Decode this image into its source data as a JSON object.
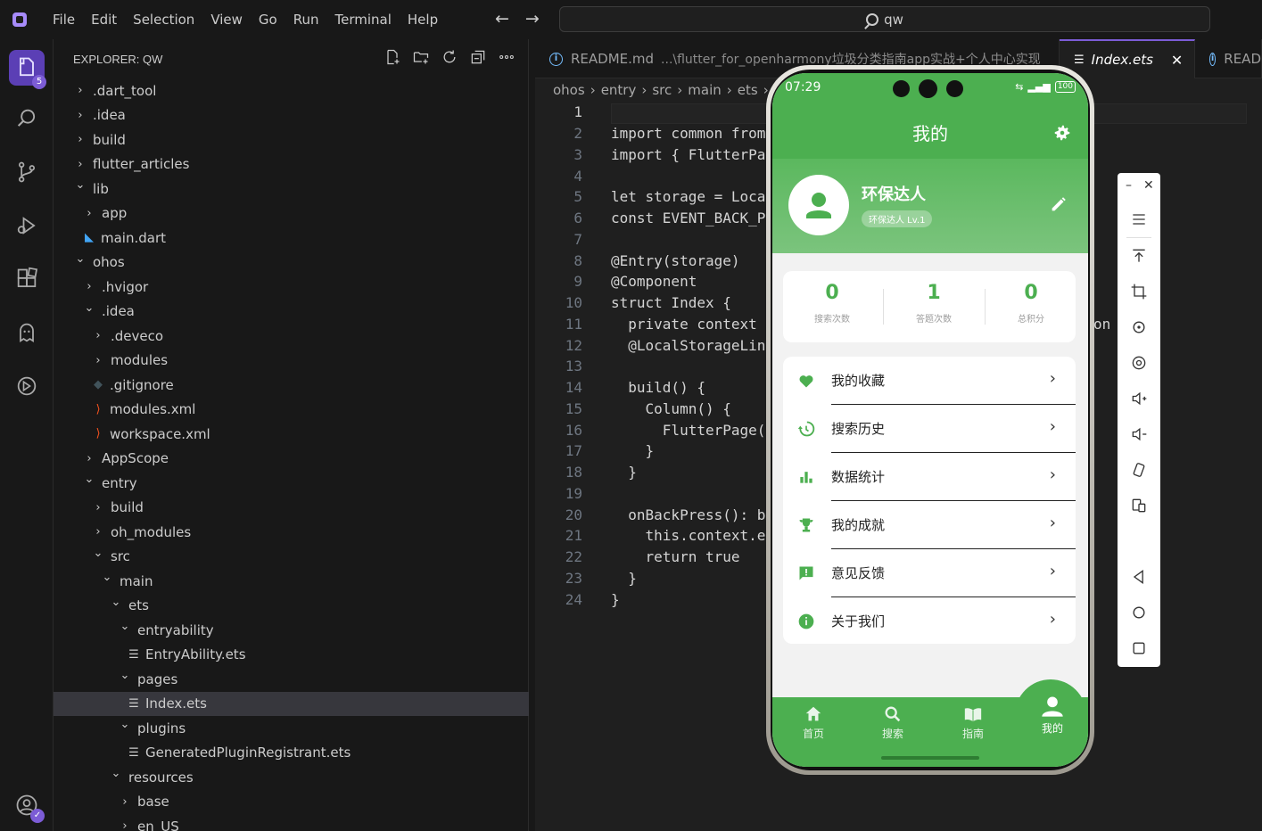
{
  "menu": [
    "File",
    "Edit",
    "Selection",
    "View",
    "Go",
    "Run",
    "Terminal",
    "Help"
  ],
  "search": {
    "text": "qw"
  },
  "activity": {
    "badge": "5"
  },
  "explorer": {
    "title": "EXPLORER: QW",
    "tree": [
      {
        "label": ".dart_tool",
        "depth": 0,
        "type": "folder",
        "open": false
      },
      {
        "label": ".idea",
        "depth": 0,
        "type": "folder",
        "open": false
      },
      {
        "label": "build",
        "depth": 0,
        "type": "folder",
        "open": false
      },
      {
        "label": "flutter_articles",
        "depth": 0,
        "type": "folder",
        "open": false
      },
      {
        "label": "lib",
        "depth": 0,
        "type": "folder",
        "open": true
      },
      {
        "label": "app",
        "depth": 1,
        "type": "folder",
        "open": false
      },
      {
        "label": "main.dart",
        "depth": 1,
        "type": "dart"
      },
      {
        "label": "ohos",
        "depth": 0,
        "type": "folder",
        "open": true
      },
      {
        "label": ".hvigor",
        "depth": 1,
        "type": "folder",
        "open": false
      },
      {
        "label": ".idea",
        "depth": 1,
        "type": "folder",
        "open": true
      },
      {
        "label": ".deveco",
        "depth": 2,
        "type": "folder",
        "open": false
      },
      {
        "label": "modules",
        "depth": 2,
        "type": "folder",
        "open": false
      },
      {
        "label": ".gitignore",
        "depth": 2,
        "type": "git"
      },
      {
        "label": "modules.xml",
        "depth": 2,
        "type": "xml"
      },
      {
        "label": "workspace.xml",
        "depth": 2,
        "type": "xml"
      },
      {
        "label": "AppScope",
        "depth": 1,
        "type": "folder",
        "open": false
      },
      {
        "label": "entry",
        "depth": 1,
        "type": "folder",
        "open": true
      },
      {
        "label": "build",
        "depth": 2,
        "type": "folder",
        "open": false
      },
      {
        "label": "oh_modules",
        "depth": 2,
        "type": "folder",
        "open": false
      },
      {
        "label": "src",
        "depth": 2,
        "type": "folder",
        "open": true
      },
      {
        "label": "main",
        "depth": 3,
        "type": "folder",
        "open": true
      },
      {
        "label": "ets",
        "depth": 4,
        "type": "folder",
        "open": true
      },
      {
        "label": "entryability",
        "depth": 5,
        "type": "folder",
        "open": true
      },
      {
        "label": "EntryAbility.ets",
        "depth": 6,
        "type": "ets"
      },
      {
        "label": "pages",
        "depth": 5,
        "type": "folder",
        "open": true
      },
      {
        "label": "Index.ets",
        "depth": 6,
        "type": "ets",
        "selected": true
      },
      {
        "label": "plugins",
        "depth": 5,
        "type": "folder",
        "open": true
      },
      {
        "label": "GeneratedPluginRegistrant.ets",
        "depth": 6,
        "type": "ets"
      },
      {
        "label": "resources",
        "depth": 4,
        "type": "folder",
        "open": true
      },
      {
        "label": "base",
        "depth": 5,
        "type": "folder",
        "open": false
      },
      {
        "label": "en_US",
        "depth": 5,
        "type": "folder",
        "open": false
      }
    ]
  },
  "tabs": [
    {
      "label": "README.md",
      "desc": "...\\flutter_for_openharmony垃圾分类指南app实战+个人中心实现",
      "active": false
    },
    {
      "label": "Index.ets",
      "active": true,
      "close": "✕"
    },
    {
      "label": "READ",
      "active": false
    }
  ],
  "breadcrumb": [
    "ohos",
    "entry",
    "src",
    "main",
    "ets"
  ],
  "code": [
    "",
    "import common from",
    "import { FlutterPa",
    "",
    "let storage = Loca",
    "const EVENT_BACK_P",
    "",
    "@Entry(storage)",
    "@Component",
    "struct Index {",
    "  private context",
    "  @LocalStorageLin",
    "",
    "  build() {",
    "    Column() {",
    "      FlutterPage(",
    "    }",
    "  }",
    "",
    "  onBackPress(): b",
    "    this.context.e",
    "    return true",
    "  }",
    "}"
  ],
  "code_overflow": "on",
  "phone": {
    "time": "07:29",
    "battery": "100",
    "title": "我的",
    "user_name": "环保达人",
    "user_level": "环保达人 Lv.1",
    "stats": [
      {
        "value": "0",
        "label": "搜索次数"
      },
      {
        "value": "1",
        "label": "答题次数"
      },
      {
        "value": "0",
        "label": "总积分"
      }
    ],
    "menu": [
      {
        "label": "我的收藏",
        "icon": "heart-icon"
      },
      {
        "label": "搜索历史",
        "icon": "history-icon"
      },
      {
        "label": "数据统计",
        "icon": "bar-chart-icon"
      },
      {
        "label": "我的成就",
        "icon": "trophy-icon"
      },
      {
        "label": "意见反馈",
        "icon": "feedback-icon"
      },
      {
        "label": "关于我们",
        "icon": "info-icon"
      }
    ],
    "tabbar": [
      {
        "label": "首页",
        "icon": "home-icon"
      },
      {
        "label": "搜索",
        "icon": "search-icon"
      },
      {
        "label": "指南",
        "icon": "book-icon"
      },
      {
        "label": "我的",
        "icon": "person-icon",
        "active": true
      }
    ],
    "accent": "#4caf50"
  }
}
